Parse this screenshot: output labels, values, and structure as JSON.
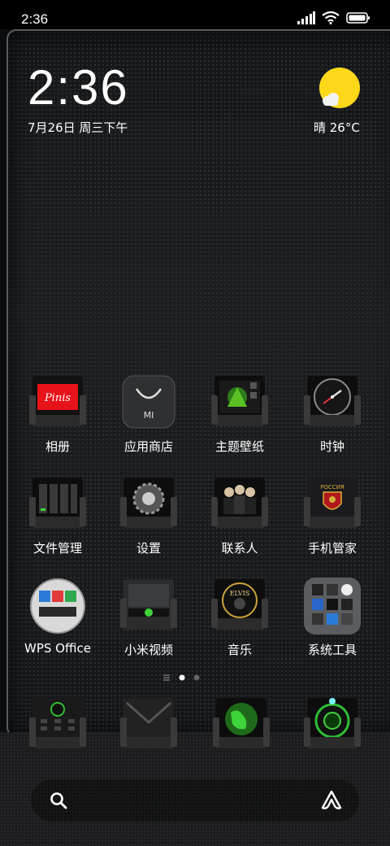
{
  "status": {
    "time": "2:36"
  },
  "lockclock": {
    "time": "2:36",
    "date": "7月26日 周三下午"
  },
  "weather": {
    "text": "晴 26°C",
    "icon": "sun-cloud-icon",
    "sun_color": "#FFD81A"
  },
  "apps": [
    {
      "label": "相册",
      "icon": "gallery-icon"
    },
    {
      "label": "应用商店",
      "icon": "app-store-icon"
    },
    {
      "label": "主题壁纸",
      "icon": "themes-icon"
    },
    {
      "label": "时钟",
      "icon": "clock-icon"
    },
    {
      "label": "文件管理",
      "icon": "file-manager-icon"
    },
    {
      "label": "设置",
      "icon": "settings-icon"
    },
    {
      "label": "联系人",
      "icon": "contacts-icon"
    },
    {
      "label": "手机管家",
      "icon": "security-icon"
    },
    {
      "label": "WPS Office",
      "icon": "wps-office-icon"
    },
    {
      "label": "小米视频",
      "icon": "video-icon"
    },
    {
      "label": "音乐",
      "icon": "music-icon"
    },
    {
      "label": "系统工具",
      "icon": "system-tools-folder-icon"
    }
  ],
  "gallery_badge": "Pinis",
  "store_badge": "MI",
  "security_badge": "РОССИЯ",
  "music_badge": "ELVIS",
  "dock": [
    {
      "icon": "phone-dialer-icon"
    },
    {
      "icon": "messages-icon"
    },
    {
      "icon": "browser-icon"
    },
    {
      "icon": "camera-icon"
    }
  ],
  "search": {
    "icon": "search-icon",
    "assistant_icon": "assistant-icon"
  }
}
